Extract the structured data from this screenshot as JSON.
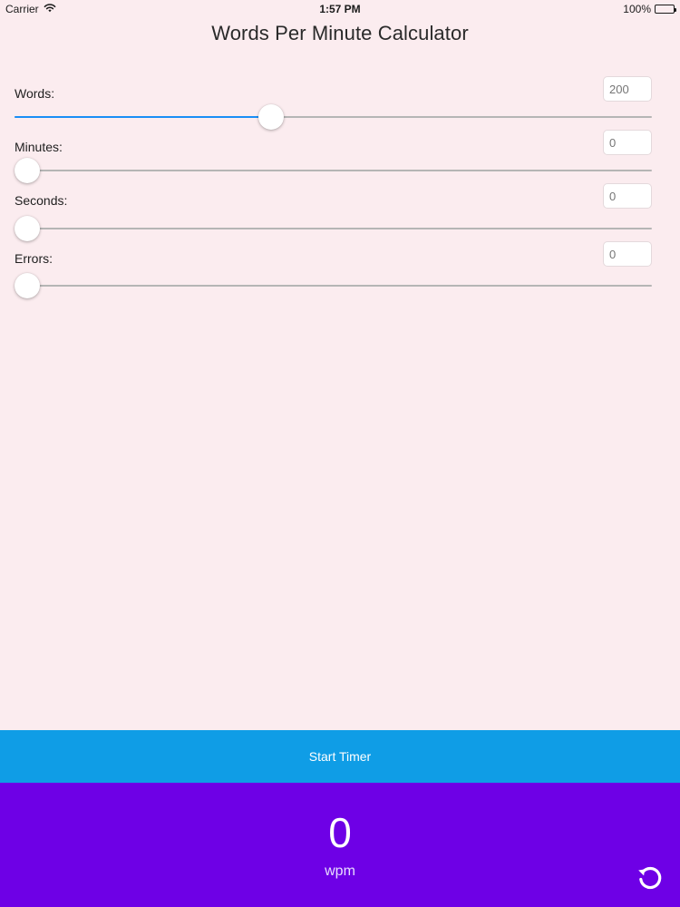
{
  "status_bar": {
    "carrier": "Carrier",
    "time": "1:57 PM",
    "battery": "100%",
    "icons": {
      "signal": "wifi-icon",
      "battery": "battery-icon"
    }
  },
  "title": "Words Per Minute Calculator",
  "sliders": [
    {
      "id": "words",
      "label": "Words:",
      "value": "200",
      "fraction": 0.403
    },
    {
      "id": "minutes",
      "label": "Minutes:",
      "value": "0",
      "fraction": 0.0
    },
    {
      "id": "seconds",
      "label": "Seconds:",
      "value": "0",
      "fraction": 0.0
    },
    {
      "id": "errors",
      "label": "Errors:",
      "value": "0",
      "fraction": 0.0
    }
  ],
  "start_button": {
    "label": "Start Timer"
  },
  "result": {
    "value": "0",
    "unit": "wpm",
    "reset_icon": "reset-icon"
  },
  "colors": {
    "background": "#fbecef",
    "accent": "#1a8ef5",
    "start_bar": "#0f9de6",
    "result_panel": "#6e00e6"
  }
}
